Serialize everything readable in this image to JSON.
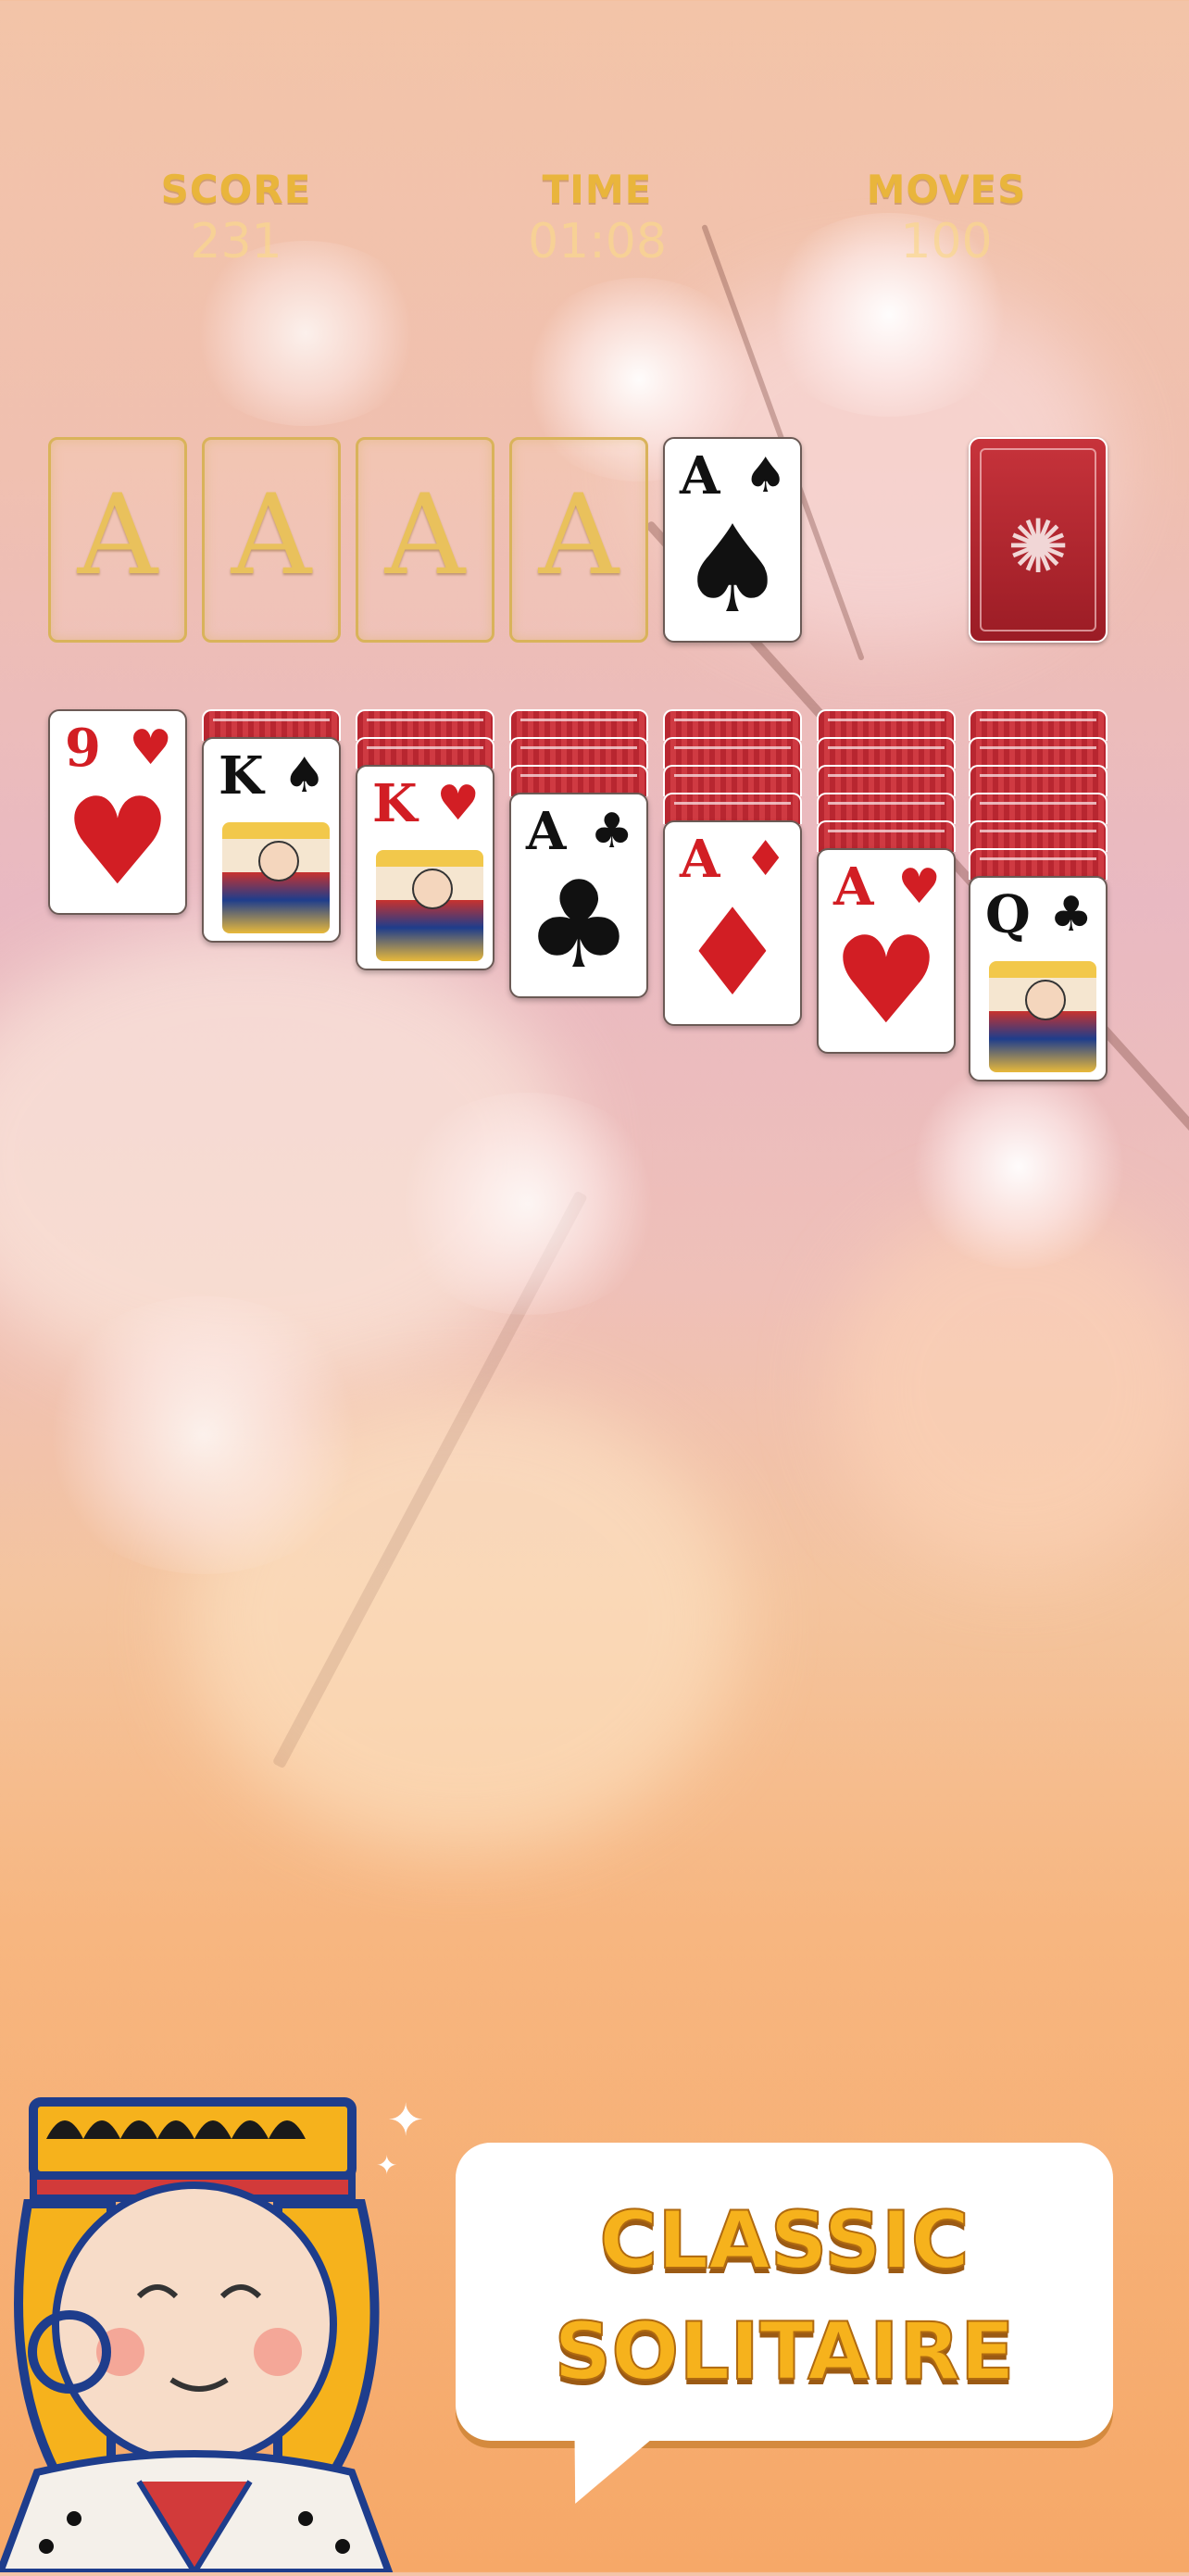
{
  "hud": {
    "score_label": "SCORE",
    "score_value": "231",
    "time_label": "TIME",
    "time_value": "01:08",
    "moves_label": "MOVES",
    "moves_value": "100"
  },
  "foundations": [
    "A",
    "A",
    "A",
    "A"
  ],
  "waste_card": {
    "rank": "A",
    "suit": "♠",
    "color": "black"
  },
  "tableau": [
    {
      "hidden": 0,
      "rank": "9",
      "suit": "♥",
      "color": "red"
    },
    {
      "hidden": 1,
      "rank": "K",
      "suit": "♠",
      "color": "black"
    },
    {
      "hidden": 2,
      "rank": "K",
      "suit": "♥",
      "color": "red"
    },
    {
      "hidden": 3,
      "rank": "A",
      "suit": "♣",
      "color": "black"
    },
    {
      "hidden": 4,
      "rank": "A",
      "suit": "♦",
      "color": "red"
    },
    {
      "hidden": 5,
      "rank": "A",
      "suit": "♥",
      "color": "red"
    },
    {
      "hidden": 6,
      "rank": "Q",
      "suit": "♣",
      "color": "black"
    }
  ],
  "banner": {
    "line1": "CLASSIC",
    "line2": "SOLITAIRE"
  },
  "colors": {
    "accent": "#e9b53c",
    "card_back": "#b82630",
    "banner_text": "#f6b21c"
  }
}
